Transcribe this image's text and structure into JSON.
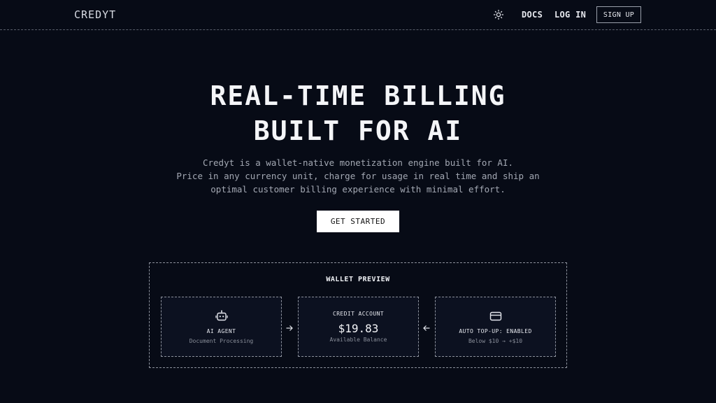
{
  "header": {
    "logo": "CREDYT",
    "theme_icon": "sun-icon",
    "nav": {
      "docs": "DOCS",
      "login": "LOG IN",
      "signup": "SIGN UP"
    }
  },
  "hero": {
    "title_line1": "REAL-TIME BILLING",
    "title_line2": "BUILT FOR AI",
    "subtitle_line1": "Credyt is a wallet-native monetization engine built for AI.",
    "subtitle_line2": "Price in any currency unit, charge for usage in real time and ship an",
    "subtitle_line3": "optimal customer billing experience with minimal effort.",
    "cta": "GET STARTED"
  },
  "wallet_preview": {
    "title": "WALLET PREVIEW",
    "cards": [
      {
        "icon": "robot-icon",
        "label": "AI AGENT",
        "sub": "Document Processing"
      },
      {
        "label": "CREDIT ACCOUNT",
        "amount": "$19.83",
        "sub": "Available Balance"
      },
      {
        "icon": "credit-card-icon",
        "label": "AUTO TOP-UP: ENABLED",
        "sub": "Below $10 → +$10"
      }
    ],
    "arrows": [
      "arrow-right-icon",
      "arrow-left-icon"
    ]
  },
  "colors": {
    "background": "#070b16",
    "card_background": "#0c1120",
    "text": "#e6e8ee",
    "muted_text": "#a3a8b3",
    "cta_background": "#ffffff"
  }
}
